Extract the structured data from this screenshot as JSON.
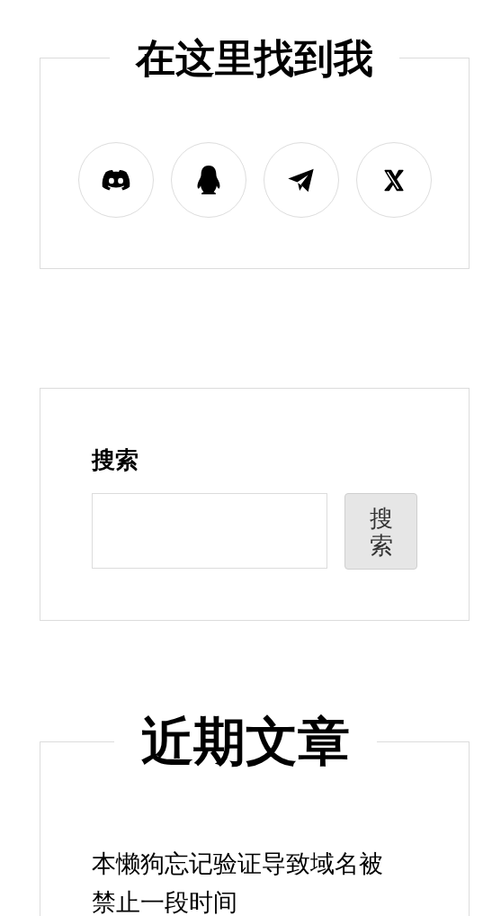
{
  "find_me": {
    "title": "在这里找到我",
    "links": [
      {
        "kind": "discord"
      },
      {
        "kind": "qq"
      },
      {
        "kind": "telegram"
      },
      {
        "kind": "x"
      }
    ]
  },
  "search": {
    "label": "搜索",
    "button": "搜索"
  },
  "recent_posts": {
    "title": "近期文章",
    "posts": [
      "本懒狗忘记验证导致域名被禁止一段时间"
    ]
  }
}
